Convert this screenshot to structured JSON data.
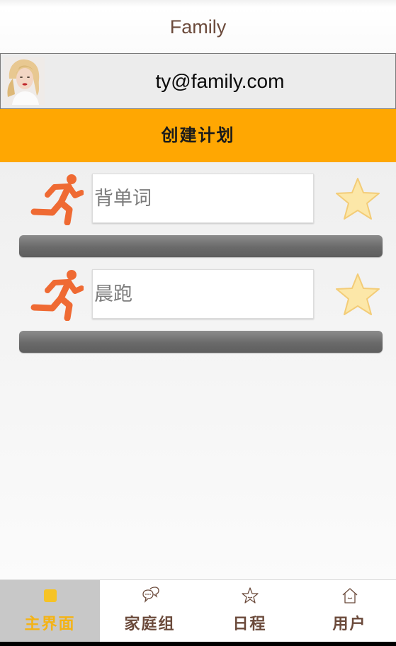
{
  "header": {
    "title": "Family"
  },
  "user": {
    "email": "ty@family.com",
    "avatar_icon": "user-avatar-photo"
  },
  "create_plan": {
    "label": "创建计划"
  },
  "plans": [
    {
      "name": "背单词",
      "icon": "running-person-icon",
      "favorite_icon": "star-icon",
      "progress": 0
    },
    {
      "name": "晨跑",
      "icon": "running-person-icon",
      "favorite_icon": "star-icon",
      "progress": 0
    }
  ],
  "tabs": [
    {
      "label": "主界面",
      "icon": "home-square-icon",
      "active": true
    },
    {
      "label": "家庭组",
      "icon": "chat-bubbles-icon",
      "active": false
    },
    {
      "label": "日程",
      "icon": "star-outline-icon",
      "active": false
    },
    {
      "label": "用户",
      "icon": "house-outline-icon",
      "active": false
    }
  ],
  "colors": {
    "accent": "#ffa702",
    "title_text": "#6b4a3b",
    "run_icon": "#ef6a33",
    "star": "#fce7a8",
    "active_tab_text": "#f4b315",
    "active_tab_bg": "#c8c8c8"
  }
}
